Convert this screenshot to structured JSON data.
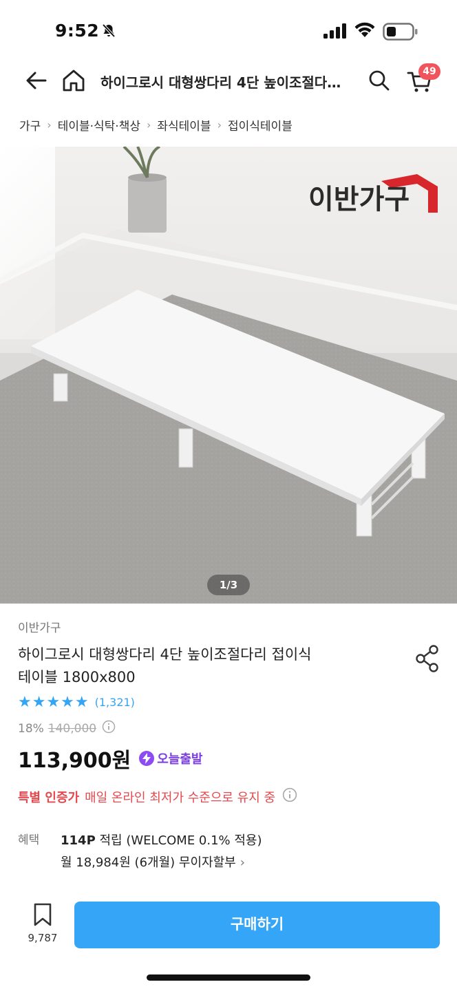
{
  "status_bar": {
    "time": "9:52"
  },
  "header": {
    "title": "하이그로시 대형쌍다리 4단 높이조절다리 접이식 테이블 1800x800",
    "cart_count": "49"
  },
  "breadcrumb": [
    "가구",
    "테이블·식탁·책상",
    "좌식테이블",
    "접이식테이블"
  ],
  "hero": {
    "brand_logo_text": "이반가구",
    "counter": "1/3"
  },
  "product": {
    "seller": "이반가구",
    "name_line1": "하이그로시 대형쌍다리 4단 높이조절다리 접이식",
    "name_line2": "테이블 1800x800",
    "rating_stars": 5,
    "rating_stars_text": "★★★★★",
    "review_count": "(1,321)",
    "discount": "18%",
    "original_price": "140,000",
    "price": "113,900원",
    "today_delivery": "오늘출발",
    "special_label": "특별 인증가",
    "special_desc": "매일 온라인 최저가 수준으로 유지 중"
  },
  "benefit": {
    "label": "혜택",
    "points": "114P",
    "points_desc": "적립 (WELCOME 0.1% 적용)",
    "installment": "월 18,984원 (6개월) 무이자할부"
  },
  "bottom_bar": {
    "bookmark_count": "9,787",
    "buy_label": "구매하기"
  },
  "colors": {
    "accent_blue": "#35a5f7",
    "badge_red": "#f0555d",
    "special_red": "#e5484d",
    "delivery_purple": "#8d4cf2"
  }
}
